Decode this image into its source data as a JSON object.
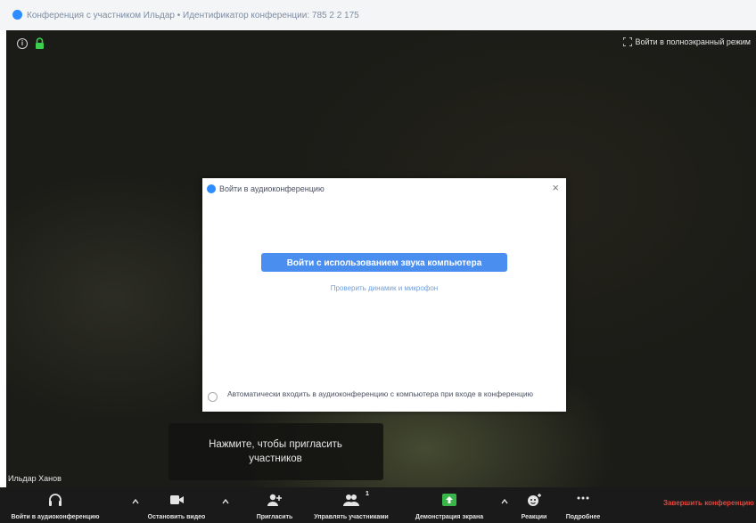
{
  "window": {
    "title": "Конференция с участником Ильдар • Идентификатор конференции: 785 2 2 175"
  },
  "video": {
    "fullscreen_label": "Войти в полноэкранный режим",
    "participant_name": "Ильдар Ханов"
  },
  "audio_dialog": {
    "title": "Войти в аудиоконференцию",
    "join_button": "Войти с использованием звука компьютера",
    "test_link": "Проверить динамик и микрофон",
    "auto_join_label": "Автоматически входить в аудиоконференцию с компьютера при входе в конференцию",
    "auto_join_checked": false
  },
  "invite_tooltip": {
    "text": "Нажмите, чтобы пригласить участников"
  },
  "toolbar": {
    "join_audio": "Войти в аудиоконференцию",
    "stop_video": "Остановить видео",
    "invite": "Пригласить",
    "manage_participants": "Управлять участниками",
    "participants_count": "1",
    "share_screen": "Демонстрация экрана",
    "reactions": "Реакции",
    "more": "Подробнее",
    "end_meeting": "Завершить конференцию"
  },
  "colors": {
    "accent": "#2d8cff",
    "share_green": "#39b54a",
    "end_red": "#e0483f",
    "toolbar_bg": "#1a1a1a"
  },
  "icons": {
    "info": "info-icon",
    "lock": "lock-icon",
    "fullscreen": "fullscreen-icon",
    "headphones": "headphones-icon",
    "video_camera": "video-camera-icon",
    "add_user": "add-user-icon",
    "participants": "participants-icon",
    "share_screen": "share-screen-icon",
    "reaction": "reaction-icon",
    "more": "more-icon"
  }
}
